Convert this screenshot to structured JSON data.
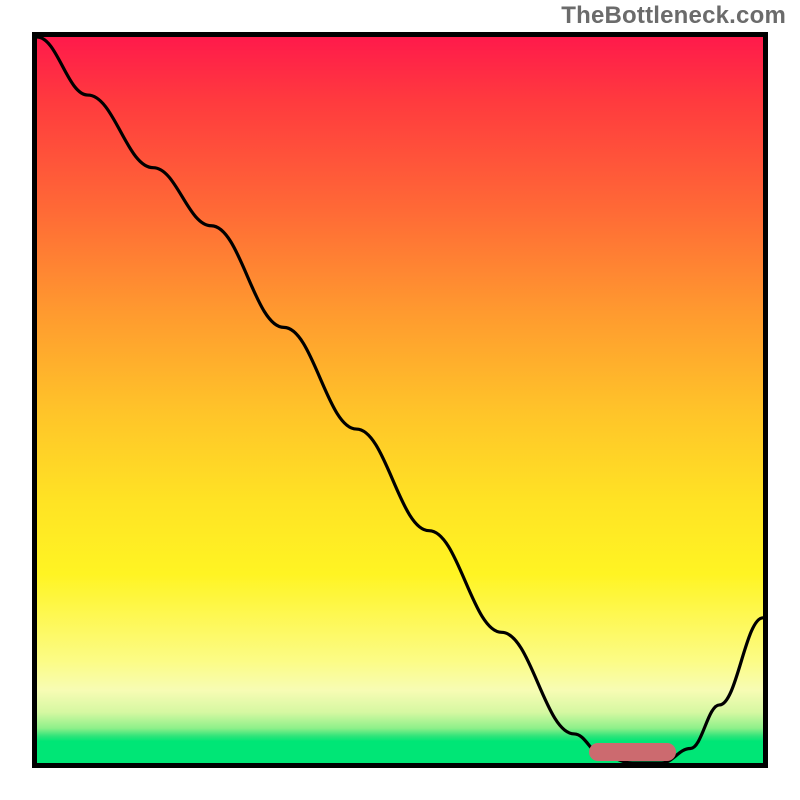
{
  "watermark": "TheBottleneck.com",
  "colors": {
    "frame": "#000000",
    "curve": "#000000",
    "marker": "#cc6a6f",
    "gradient_stops": [
      "#ff1a4b",
      "#ff3b3e",
      "#ff6a36",
      "#ff9a2f",
      "#ffc529",
      "#ffe324",
      "#fff423",
      "#fcfc86",
      "#f7fcb4",
      "#d6f8a2",
      "#8ef08a",
      "#2fe47a",
      "#00e676"
    ]
  },
  "chart_data": {
    "type": "line",
    "title": "",
    "xlabel": "",
    "ylabel": "",
    "xlim": [
      0,
      100
    ],
    "ylim": [
      0,
      100
    ],
    "series": [
      {
        "name": "curve",
        "x": [
          0,
          7,
          16,
          24,
          34,
          44,
          54,
          64,
          74,
          78,
          82,
          86,
          90,
          94,
          100
        ],
        "y": [
          100,
          92,
          82,
          74,
          60,
          46,
          32,
          18,
          4,
          1,
          0,
          0,
          2,
          8,
          20
        ]
      }
    ],
    "marker": {
      "x_start": 76,
      "x_end": 88,
      "y": 1.5,
      "note": "optimal-range indicator (rounded red bar near x-axis)"
    },
    "legend": [],
    "grid": false
  }
}
